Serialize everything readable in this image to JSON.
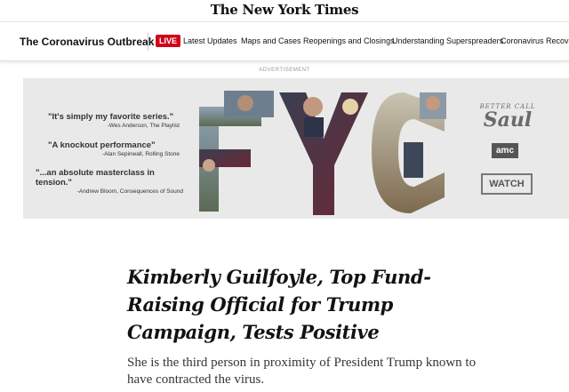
{
  "masthead": {
    "logo_text": "The New York Times"
  },
  "nav": {
    "section_title": "The Coronavirus Outbreak ›",
    "live_badge": "LIVE",
    "links": [
      "Latest Updates",
      "Maps and Cases",
      "Reopenings and Closings",
      "Understanding Superspreaders",
      "Coronavirus Recovery"
    ]
  },
  "ad": {
    "label": "ADVERTISEMENT",
    "quotes": [
      {
        "text": "\"It's simply my favorite series.\"",
        "attribution": "-Wes Anderson, The Playlist"
      },
      {
        "text": "\"A knockout performance\"",
        "attribution": "-Alan Sepinwall, Rolling Stone"
      },
      {
        "text": "\"...an absolute masterclass in tension.\"",
        "attribution": "-Andrew Bloom, Consequences of Sound"
      }
    ],
    "fyc_letters": [
      "F",
      "Y",
      "C"
    ],
    "show_title_top": "BETTER CALL",
    "show_title_main": "Saul",
    "network": "amc",
    "cta": "WATCH"
  },
  "article": {
    "headline": "Kimberly Guilfoyle, Top Fund-Raising Official for Trump Campaign, Tests Positive",
    "summary": "She is the third person in proximity of President Trump known to have contracted the virus."
  },
  "colors": {
    "live_red": "#d0021b",
    "ad_background": "#e9e9e9"
  }
}
